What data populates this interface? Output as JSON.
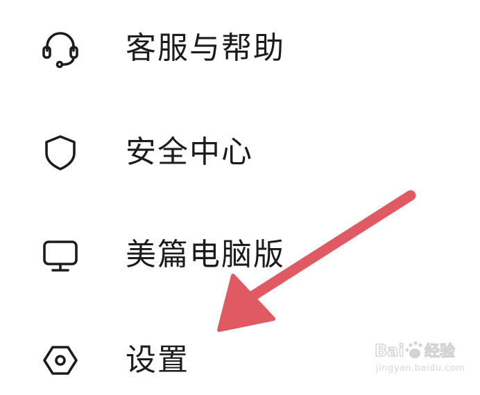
{
  "menu": {
    "items": [
      {
        "label": "客服与帮助",
        "icon": "headset-icon"
      },
      {
        "label": "安全中心",
        "icon": "shield-icon"
      },
      {
        "label": "美篇电脑版",
        "icon": "monitor-icon"
      },
      {
        "label": "设置",
        "icon": "settings-hexagon-icon"
      }
    ]
  },
  "colors": {
    "text": "#1c1c1c",
    "icon_stroke": "#1c1c1c",
    "arrow": "#e05a64",
    "background": "#ffffff"
  },
  "watermark": {
    "brand": "Baidu经验",
    "url": "jingyan.baidu.com"
  }
}
